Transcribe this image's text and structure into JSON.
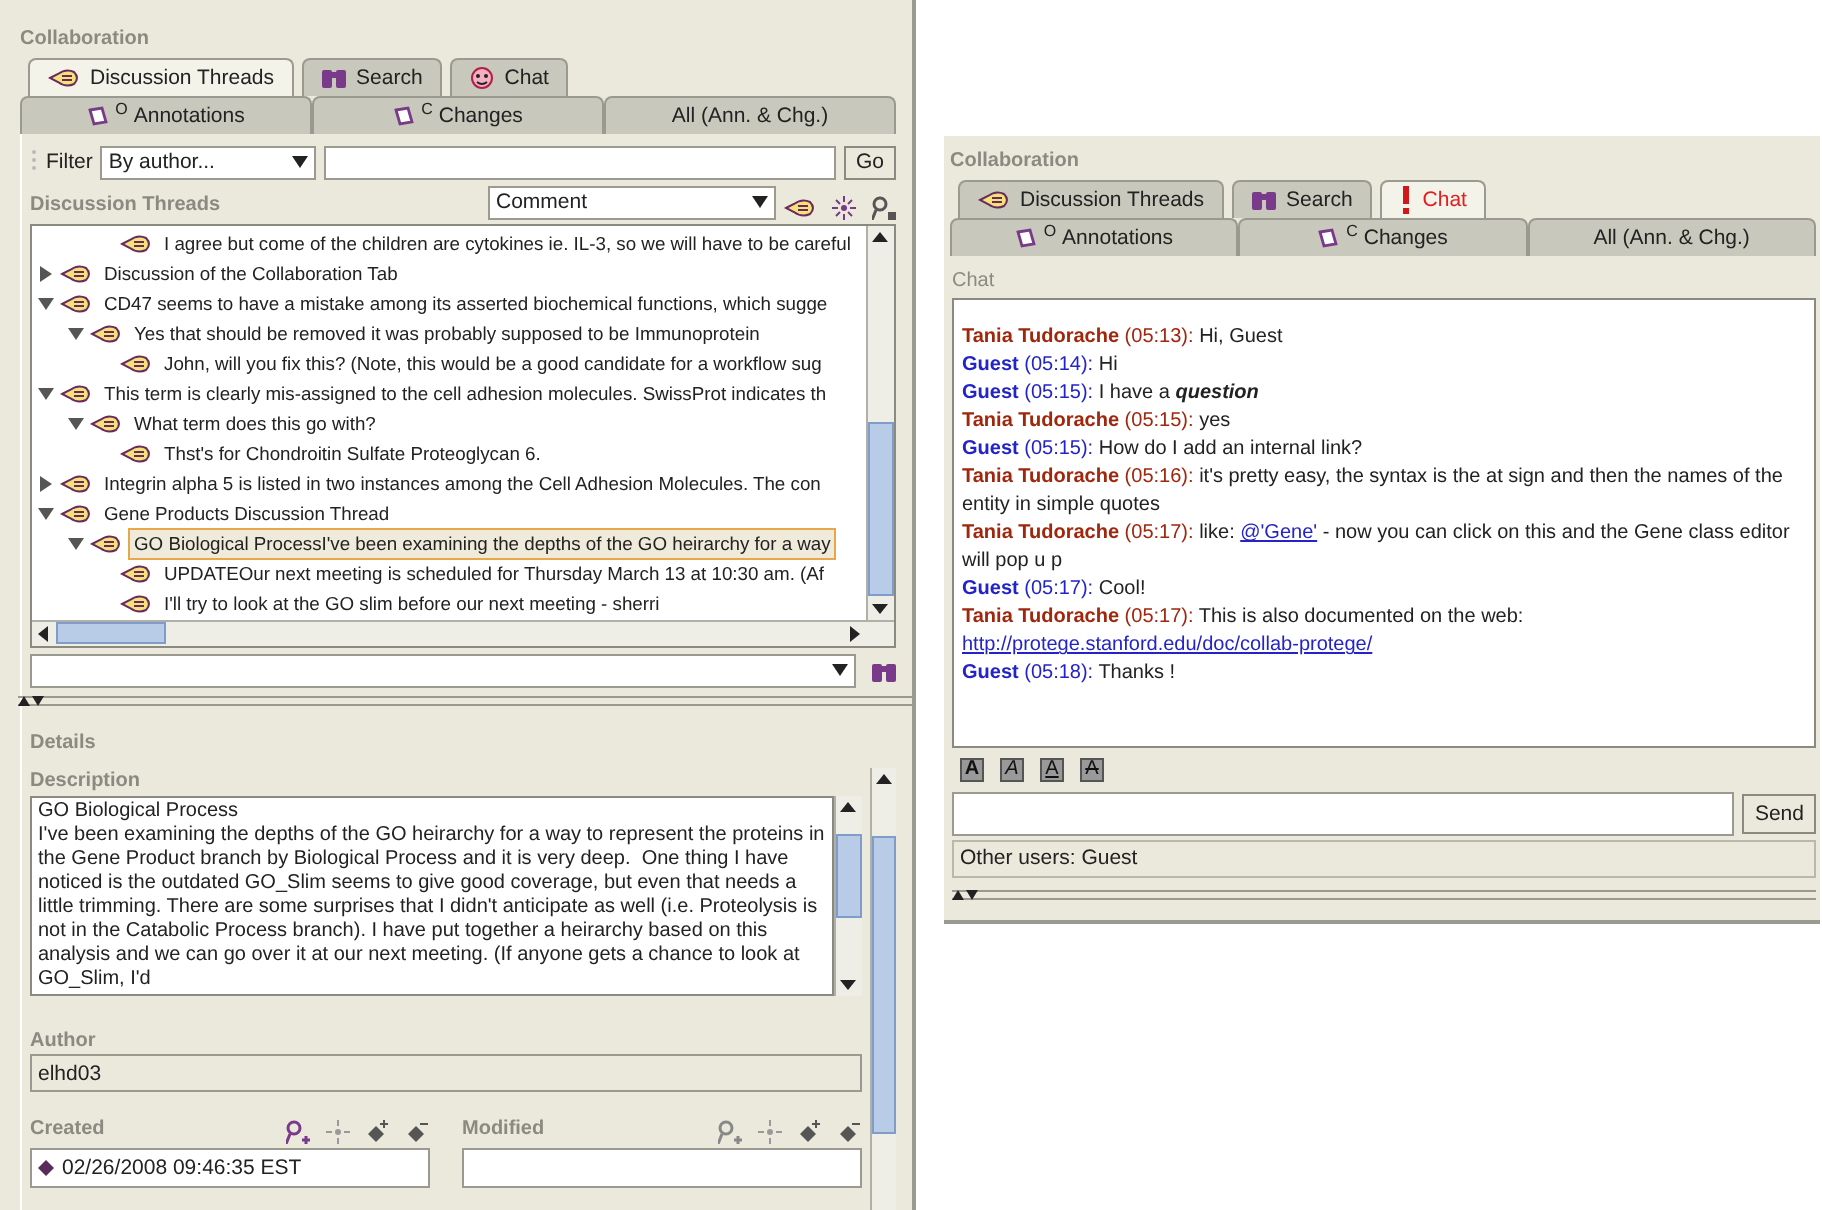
{
  "left": {
    "title": "Collaboration",
    "tabs": [
      {
        "label": "Discussion Threads",
        "kind": "threads",
        "selected": true,
        "alert": false
      },
      {
        "label": "Search",
        "kind": "search",
        "selected": false,
        "alert": false
      },
      {
        "label": "Chat",
        "kind": "chat",
        "selected": false,
        "alert": false
      }
    ],
    "subtabs": [
      {
        "label": "Annotations",
        "mark": "O"
      },
      {
        "label": "Changes",
        "mark": "C"
      },
      {
        "label": "All (Ann. & Chg.)"
      }
    ],
    "filter": {
      "label": "Filter",
      "option": "By author...",
      "button": "Go"
    },
    "threads": {
      "title": "Discussion Threads",
      "type_option": "Comment",
      "partial_top": [
        {
          "text": "I agree but come of the children are cytokines  ie. IL-3, so we will have to be careful",
          "selected": false
        }
      ],
      "items": [
        {
          "text": "Discussion of the Collaboration Tab",
          "selected": false,
          "expanded": false
        },
        {
          "text": "CD47 seems to have a mistake among its asserted biochemical functions, which sugge",
          "selected": false,
          "expanded": true,
          "children": [
            {
              "text": "Yes that should be removed it was probably supposed to be Immunoprotein",
              "selected": false,
              "expanded": true,
              "children": [
                {
                  "text": "John, will you fix this?  (Note, this would be a good candidate for a workflow sug",
                  "selected": false
                }
              ]
            }
          ]
        },
        {
          "text": "This term is clearly mis-assigned to the cell adhesion molecules. SwissProt indicates th",
          "selected": false,
          "expanded": true,
          "children": [
            {
              "text": "What term does this go with?",
              "selected": false,
              "expanded": true,
              "children": [
                {
                  "text": "Thst's for Chondroitin Sulfate Proteoglycan 6.",
                  "selected": false
                }
              ]
            }
          ]
        },
        {
          "text": "Integrin alpha 5 is listed in two instances among the Cell Adhesion Molecules. The con",
          "selected": false,
          "expanded": false
        },
        {
          "text": "Gene Products Discussion Thread",
          "selected": false,
          "expanded": true,
          "children": [
            {
              "text": "GO Biological ProcessI've been examining the depths of the GO heirarchy for a way",
              "selected": true,
              "expanded": true,
              "children": [
                {
                  "text": "UPDATEOur next meeting is scheduled for Thursday March 13 at 10:30 am. (Af",
                  "selected": false
                },
                {
                  "text": "I'll try to look at the GO slim before our next meeting - sherri",
                  "selected": false
                }
              ]
            }
          ]
        }
      ]
    },
    "details": {
      "title": "Details",
      "description_label": "Description",
      "description": "GO Biological Process\nI've been examining the depths of the GO heirarchy for a way to represent the proteins in the Gene Product branch by Biological Process and it is very deep.  One thing I have noticed is the outdated GO_Slim seems to give good coverage, but even that needs a little trimming. There are some surprises that I didn't anticipate as well (i.e. Proteolysis is not in the Catabolic Process branch). I have put together a heirarchy based on this analysis and we can go over it at our next meeting. (If anyone gets a chance to look at GO_Slim, I'd",
      "author_label": "Author",
      "author": "elhd03",
      "created_label": "Created",
      "created": "02/26/2008 09:46:35 EST",
      "modified_label": "Modified"
    }
  },
  "right": {
    "title": "Collaboration",
    "tabs": [
      {
        "label": "Discussion Threads",
        "kind": "threads",
        "selected": false,
        "alert": false
      },
      {
        "label": "Search",
        "kind": "search",
        "selected": false,
        "alert": false
      },
      {
        "label": "Chat",
        "kind": "chat",
        "selected": true,
        "alert": true
      }
    ],
    "subtabs": [
      {
        "label": "Annotations",
        "mark": "O"
      },
      {
        "label": "Changes",
        "mark": "C"
      },
      {
        "label": "All (Ann. & Chg.)"
      }
    ],
    "chat": {
      "title": "Chat",
      "messages": [
        {
          "author": "Tania Tudorache",
          "time": "(05:13):",
          "color": "#a0260c",
          "parts": [
            {
              "kind": "text",
              "text": "Hi, Guest"
            }
          ]
        },
        {
          "author": "Guest",
          "time": "(05:14):",
          "color": "#2323c8",
          "parts": [
            {
              "kind": "text",
              "text": "Hi"
            }
          ]
        },
        {
          "author": "Guest",
          "time": "(05:15):",
          "color": "#2323c8",
          "parts": [
            {
              "kind": "text",
              "text": "I have a "
            },
            {
              "kind": "emphasis",
              "text": "question"
            }
          ]
        },
        {
          "author": "Tania Tudorache",
          "time": "(05:15):",
          "color": "#a0260c",
          "parts": [
            {
              "kind": "text",
              "text": "yes"
            }
          ]
        },
        {
          "author": "Guest",
          "time": "(05:15):",
          "color": "#2323c8",
          "parts": [
            {
              "kind": "text",
              "text": "How do I add an internal link?"
            }
          ]
        },
        {
          "author": "Tania Tudorache",
          "time": "(05:16):",
          "color": "#a0260c",
          "parts": [
            {
              "kind": "text",
              "text": "it's pretty easy, the syntax is the at sign and then the names of the entity in simple quotes"
            }
          ]
        },
        {
          "author": "Tania Tudorache",
          "time": "(05:17):",
          "color": "#a0260c",
          "parts": [
            {
              "kind": "text",
              "text": "like: "
            },
            {
              "kind": "link",
              "text": "@'Gene'"
            },
            {
              "kind": "text",
              "text": " - now you can click on this and the Gene class editor will pop u p"
            }
          ]
        },
        {
          "author": "Guest",
          "time": "(05:17):",
          "color": "#2323c8",
          "parts": [
            {
              "kind": "text",
              "text": "Cool!"
            }
          ]
        },
        {
          "author": "Tania Tudorache",
          "time": "(05:17):",
          "color": "#a0260c",
          "parts": [
            {
              "kind": "text",
              "text": "This is also documented on the web: "
            },
            {
              "kind": "link",
              "text": "http://protege.stanford.edu/doc/collab-protege/"
            }
          ]
        },
        {
          "author": "Guest",
          "time": "(05:18):",
          "color": "#2323c8",
          "parts": [
            {
              "kind": "text",
              "text": "Thanks !"
            }
          ]
        }
      ],
      "format_buttons": [
        {
          "kind": "bold",
          "label": "A"
        },
        {
          "kind": "italic",
          "label": "A"
        },
        {
          "kind": "underline",
          "label": "A"
        },
        {
          "kind": "strike",
          "label": "A"
        }
      ],
      "send": "Send",
      "other_users": "Other users: Guest"
    }
  }
}
